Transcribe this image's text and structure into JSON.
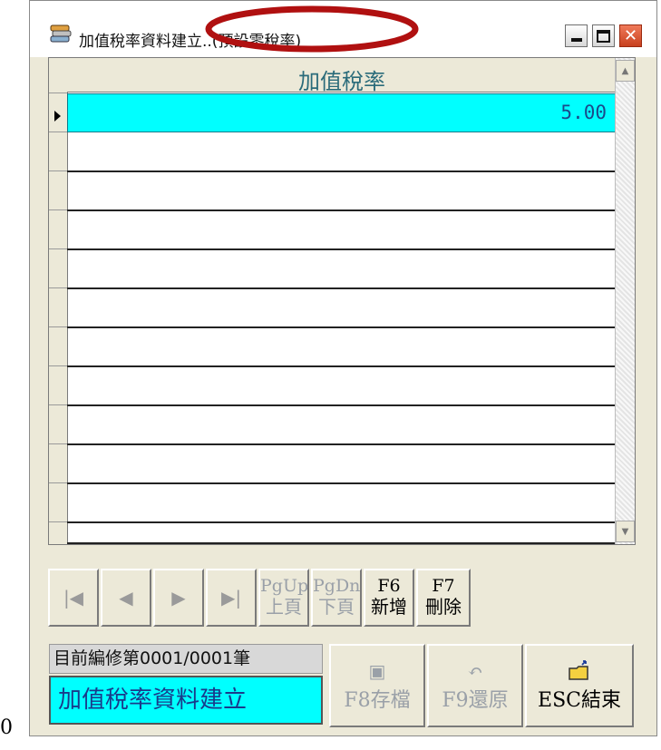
{
  "stray_text": "0",
  "window": {
    "title": "加值稅率資料建立..(預設零稅率)",
    "icon": "app-stack-icon",
    "controls": [
      "minimize-icon",
      "maximize-icon",
      "close-icon"
    ]
  },
  "grid": {
    "column_header": "加值稅率",
    "rows": [
      {
        "value": "5.00",
        "selected": true
      }
    ],
    "empty_rows": 11,
    "colors": {
      "selected_row": "#00ffff",
      "header_text": "#2a6b7a",
      "annotation_ring": "#b01010"
    }
  },
  "nav": {
    "first_icon": "first-record-icon",
    "prev_icon": "previous-record-icon",
    "next_icon": "next-record-icon",
    "last_icon": "last-record-icon",
    "pgup": {
      "key": "PgUp",
      "label": "上頁"
    },
    "pgdn": {
      "key": "PgDn",
      "label": "下頁"
    },
    "f6": {
      "key": "F6",
      "label": "新增"
    },
    "f7": {
      "key": "F7",
      "label": "刪除"
    }
  },
  "status": {
    "record_text": "目前編修第0001/0001筆",
    "module_title": "加值稅率資料建立"
  },
  "actions": {
    "save": {
      "label": "F8存檔",
      "icon": "save-icon"
    },
    "restore": {
      "label": "F9還原",
      "icon": "undo-icon"
    },
    "exit": {
      "label": "ESC結束",
      "icon": "exit-folder-icon"
    }
  }
}
